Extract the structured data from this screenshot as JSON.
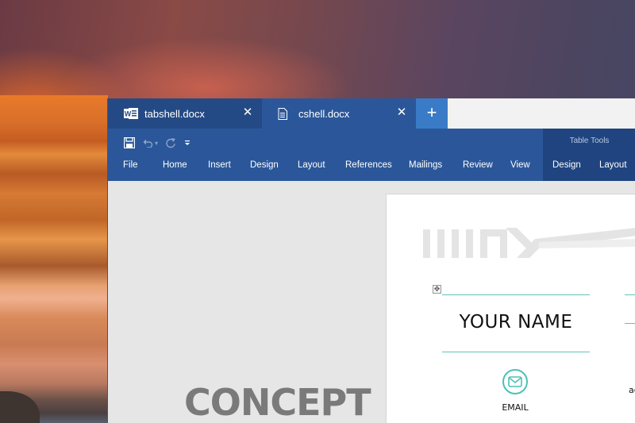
{
  "tabs": [
    {
      "label": "tabshell.docx",
      "icon": "word-app-icon",
      "active": false,
      "close": "✕"
    },
    {
      "label": "cshell.docx",
      "icon": "document-icon",
      "active": true,
      "close": "✕"
    }
  ],
  "new_tab": "+",
  "quick_access": {
    "save": "save-icon",
    "undo": "undo-icon",
    "undo_dropdown": "▾",
    "redo": "redo-icon",
    "customize": "customize-qat-icon"
  },
  "ribbon": {
    "menu": [
      "File",
      "Home",
      "Insert",
      "Design",
      "Layout",
      "References",
      "Mailings",
      "Review",
      "View"
    ],
    "contextual_group": {
      "title": "Table Tools",
      "tabs": [
        "Design",
        "Layout"
      ]
    }
  },
  "document": {
    "background_heading": "CONCEPT",
    "name_placeholder": "YOUR NAME",
    "email_label": "EMAIL",
    "address_fragment": "ac",
    "table_move_handle": "✥"
  },
  "colors": {
    "ribbon": "#2b579a",
    "tab_inactive": "#244a85",
    "new_tab": "#3a7bc8",
    "contextual": "#1f4480",
    "accent_teal": "#5ec4bd"
  }
}
